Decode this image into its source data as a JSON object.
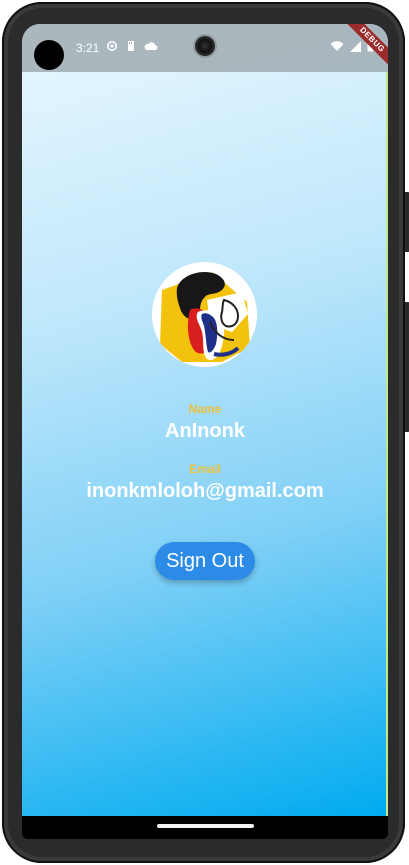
{
  "status_bar": {
    "time": "3:21",
    "left_icons": [
      "settings-icon",
      "sd-card-icon",
      "cloud-icon"
    ],
    "right_icons": [
      "wifi-icon",
      "signal-icon",
      "battery-icon"
    ]
  },
  "debug_banner": {
    "text": "DEBUG"
  },
  "profile": {
    "avatar_icon": "profile-avatar",
    "name_label": "Name",
    "name_value": "AnInonk",
    "email_label": "Email",
    "email_value": "inonkmloloh@gmail.com",
    "sign_out_label": "Sign Out"
  },
  "colors": {
    "label_color": "#f0c23a",
    "button_color": "#2b8be6",
    "background_top": "#e9f8ff",
    "background_bottom": "#00abf0"
  }
}
